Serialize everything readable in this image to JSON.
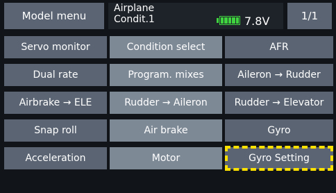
{
  "header": {
    "menu_label": "Model menu",
    "model_name": "Airplane",
    "condition": "Condit.1",
    "voltage": "7.8V",
    "page": "1/1"
  },
  "menu": {
    "rows": [
      [
        "Servo monitor",
        "Condition select",
        "AFR"
      ],
      [
        "Dual rate",
        "Program. mixes",
        "Aileron → Rudder"
      ],
      [
        "Airbrake → ELE",
        "Rudder → Aileron",
        "Rudder → Elevator"
      ],
      [
        "Snap roll",
        "Air brake",
        "Gyro"
      ],
      [
        "Acceleration",
        "Motor",
        "Gyro Setting"
      ]
    ]
  },
  "highlighted_item": "Gyro Setting",
  "colors": {
    "button_dark": "#5a6472",
    "button_light": "#7e8996",
    "battery": "#3fd43f",
    "highlight": "#ffe100"
  }
}
